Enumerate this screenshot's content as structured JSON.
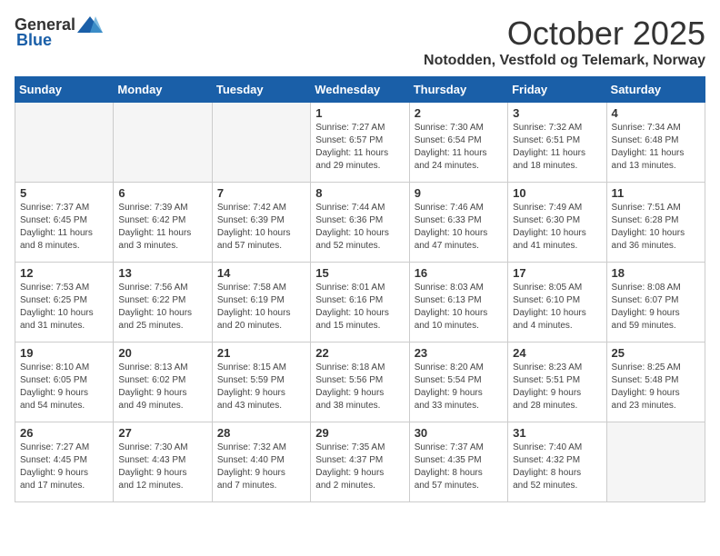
{
  "logo": {
    "general": "General",
    "blue": "Blue"
  },
  "header": {
    "month": "October 2025",
    "location": "Notodden, Vestfold og Telemark, Norway"
  },
  "weekdays": [
    "Sunday",
    "Monday",
    "Tuesday",
    "Wednesday",
    "Thursday",
    "Friday",
    "Saturday"
  ],
  "weeks": [
    [
      {
        "day": "",
        "info": ""
      },
      {
        "day": "",
        "info": ""
      },
      {
        "day": "",
        "info": ""
      },
      {
        "day": "1",
        "info": "Sunrise: 7:27 AM\nSunset: 6:57 PM\nDaylight: 11 hours\nand 29 minutes."
      },
      {
        "day": "2",
        "info": "Sunrise: 7:30 AM\nSunset: 6:54 PM\nDaylight: 11 hours\nand 24 minutes."
      },
      {
        "day": "3",
        "info": "Sunrise: 7:32 AM\nSunset: 6:51 PM\nDaylight: 11 hours\nand 18 minutes."
      },
      {
        "day": "4",
        "info": "Sunrise: 7:34 AM\nSunset: 6:48 PM\nDaylight: 11 hours\nand 13 minutes."
      }
    ],
    [
      {
        "day": "5",
        "info": "Sunrise: 7:37 AM\nSunset: 6:45 PM\nDaylight: 11 hours\nand 8 minutes."
      },
      {
        "day": "6",
        "info": "Sunrise: 7:39 AM\nSunset: 6:42 PM\nDaylight: 11 hours\nand 3 minutes."
      },
      {
        "day": "7",
        "info": "Sunrise: 7:42 AM\nSunset: 6:39 PM\nDaylight: 10 hours\nand 57 minutes."
      },
      {
        "day": "8",
        "info": "Sunrise: 7:44 AM\nSunset: 6:36 PM\nDaylight: 10 hours\nand 52 minutes."
      },
      {
        "day": "9",
        "info": "Sunrise: 7:46 AM\nSunset: 6:33 PM\nDaylight: 10 hours\nand 47 minutes."
      },
      {
        "day": "10",
        "info": "Sunrise: 7:49 AM\nSunset: 6:30 PM\nDaylight: 10 hours\nand 41 minutes."
      },
      {
        "day": "11",
        "info": "Sunrise: 7:51 AM\nSunset: 6:28 PM\nDaylight: 10 hours\nand 36 minutes."
      }
    ],
    [
      {
        "day": "12",
        "info": "Sunrise: 7:53 AM\nSunset: 6:25 PM\nDaylight: 10 hours\nand 31 minutes."
      },
      {
        "day": "13",
        "info": "Sunrise: 7:56 AM\nSunset: 6:22 PM\nDaylight: 10 hours\nand 25 minutes."
      },
      {
        "day": "14",
        "info": "Sunrise: 7:58 AM\nSunset: 6:19 PM\nDaylight: 10 hours\nand 20 minutes."
      },
      {
        "day": "15",
        "info": "Sunrise: 8:01 AM\nSunset: 6:16 PM\nDaylight: 10 hours\nand 15 minutes."
      },
      {
        "day": "16",
        "info": "Sunrise: 8:03 AM\nSunset: 6:13 PM\nDaylight: 10 hours\nand 10 minutes."
      },
      {
        "day": "17",
        "info": "Sunrise: 8:05 AM\nSunset: 6:10 PM\nDaylight: 10 hours\nand 4 minutes."
      },
      {
        "day": "18",
        "info": "Sunrise: 8:08 AM\nSunset: 6:07 PM\nDaylight: 9 hours\nand 59 minutes."
      }
    ],
    [
      {
        "day": "19",
        "info": "Sunrise: 8:10 AM\nSunset: 6:05 PM\nDaylight: 9 hours\nand 54 minutes."
      },
      {
        "day": "20",
        "info": "Sunrise: 8:13 AM\nSunset: 6:02 PM\nDaylight: 9 hours\nand 49 minutes."
      },
      {
        "day": "21",
        "info": "Sunrise: 8:15 AM\nSunset: 5:59 PM\nDaylight: 9 hours\nand 43 minutes."
      },
      {
        "day": "22",
        "info": "Sunrise: 8:18 AM\nSunset: 5:56 PM\nDaylight: 9 hours\nand 38 minutes."
      },
      {
        "day": "23",
        "info": "Sunrise: 8:20 AM\nSunset: 5:54 PM\nDaylight: 9 hours\nand 33 minutes."
      },
      {
        "day": "24",
        "info": "Sunrise: 8:23 AM\nSunset: 5:51 PM\nDaylight: 9 hours\nand 28 minutes."
      },
      {
        "day": "25",
        "info": "Sunrise: 8:25 AM\nSunset: 5:48 PM\nDaylight: 9 hours\nand 23 minutes."
      }
    ],
    [
      {
        "day": "26",
        "info": "Sunrise: 7:27 AM\nSunset: 4:45 PM\nDaylight: 9 hours\nand 17 minutes."
      },
      {
        "day": "27",
        "info": "Sunrise: 7:30 AM\nSunset: 4:43 PM\nDaylight: 9 hours\nand 12 minutes."
      },
      {
        "day": "28",
        "info": "Sunrise: 7:32 AM\nSunset: 4:40 PM\nDaylight: 9 hours\nand 7 minutes."
      },
      {
        "day": "29",
        "info": "Sunrise: 7:35 AM\nSunset: 4:37 PM\nDaylight: 9 hours\nand 2 minutes."
      },
      {
        "day": "30",
        "info": "Sunrise: 7:37 AM\nSunset: 4:35 PM\nDaylight: 8 hours\nand 57 minutes."
      },
      {
        "day": "31",
        "info": "Sunrise: 7:40 AM\nSunset: 4:32 PM\nDaylight: 8 hours\nand 52 minutes."
      },
      {
        "day": "",
        "info": ""
      }
    ]
  ]
}
